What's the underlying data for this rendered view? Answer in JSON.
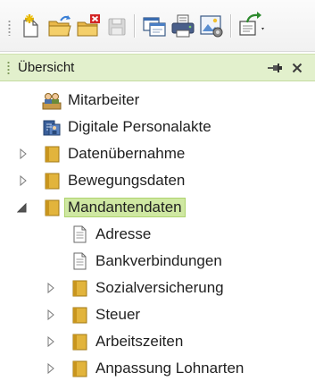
{
  "toolbar": {
    "buttons": [
      {
        "name": "new-icon"
      },
      {
        "name": "open-folder-icon"
      },
      {
        "name": "delete-folder-icon"
      },
      {
        "name": "save-icon"
      },
      {
        "name": "window-icon"
      },
      {
        "name": "print-icon"
      },
      {
        "name": "image-settings-icon"
      },
      {
        "name": "export-icon"
      }
    ]
  },
  "panel": {
    "title": "Übersicht"
  },
  "tree": {
    "items": [
      {
        "label": "Mitarbeiter",
        "icon": "employees-icon",
        "level": 0,
        "expander": "none"
      },
      {
        "label": "Digitale Personalakte",
        "icon": "personnel-file-icon",
        "level": 0,
        "expander": "none"
      },
      {
        "label": "Datenübernahme",
        "icon": "folder-icon",
        "level": 0,
        "expander": "collapsed"
      },
      {
        "label": "Bewegungsdaten",
        "icon": "folder-icon",
        "level": 0,
        "expander": "collapsed"
      },
      {
        "label": "Mandantendaten",
        "icon": "folder-icon",
        "level": 0,
        "expander": "expanded",
        "selected": true
      },
      {
        "label": "Adresse",
        "icon": "document-icon",
        "level": 1,
        "expander": "none"
      },
      {
        "label": "Bankverbindungen",
        "icon": "document-icon",
        "level": 1,
        "expander": "none"
      },
      {
        "label": "Sozialversicherung",
        "icon": "folder-icon",
        "level": 1,
        "expander": "collapsed"
      },
      {
        "label": "Steuer",
        "icon": "folder-icon",
        "level": 1,
        "expander": "collapsed"
      },
      {
        "label": "Arbeitszeiten",
        "icon": "folder-icon",
        "level": 1,
        "expander": "collapsed"
      },
      {
        "label": "Anpassung Lohnarten",
        "icon": "folder-icon",
        "level": 1,
        "expander": "collapsed"
      }
    ]
  },
  "colors": {
    "header_bg": "#e2f0cc",
    "selection_bg": "#cfe8a2",
    "folder": "#e2b43c"
  }
}
